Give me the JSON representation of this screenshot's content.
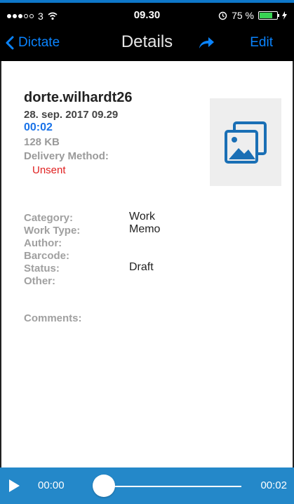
{
  "status_bar": {
    "carrier": "3",
    "time": "09.30",
    "battery_percent": "75 %",
    "battery_level": 0.75
  },
  "nav": {
    "back_label": "Dictate",
    "title": "Details",
    "edit_label": "Edit"
  },
  "recording": {
    "name": "dorte.wilhardt26",
    "date": "28. sep. 2017 09.29",
    "duration": "00:02",
    "size": "128 KB",
    "delivery_label": "Delivery Method:",
    "delivery_value": "Unsent"
  },
  "meta": {
    "category_label": "Category:",
    "category_value": "Work",
    "worktype_label": "Work Type:",
    "worktype_value": "Memo",
    "author_label": "Author:",
    "barcode_label": "Barcode:",
    "status_label": "Status:",
    "status_value": "Draft",
    "other_label": "Other:",
    "comments_label": "Comments:"
  },
  "player": {
    "current_time": "00:00",
    "total_time": "00:02",
    "progress": 0
  },
  "icons": {
    "signal": "signal-dots-icon",
    "wifi": "wifi-icon",
    "alarm": "alarm-icon",
    "battery": "battery-icon",
    "back": "chevron-left-icon",
    "share": "share-arrow-icon",
    "image": "image-gallery-icon",
    "play": "play-icon"
  },
  "colors": {
    "accent": "#0a84ff",
    "player": "#2488c9",
    "unsent": "#e02020",
    "duration": "#1a73e8"
  }
}
